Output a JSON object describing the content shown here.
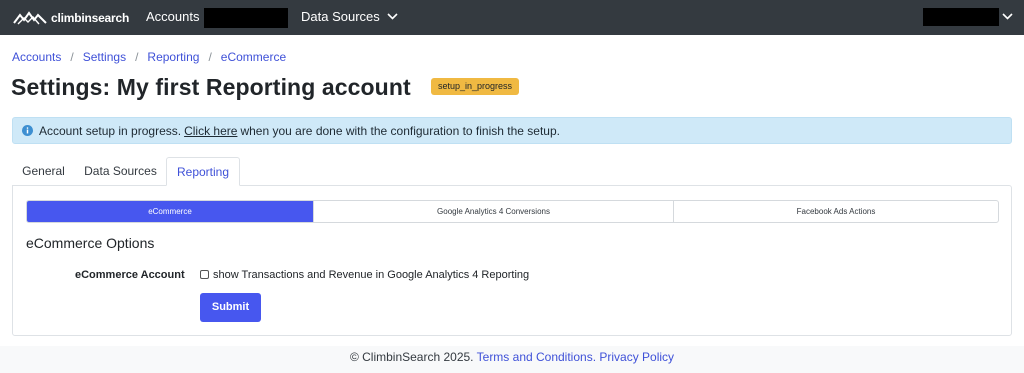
{
  "nav": {
    "brand": "climbinsearch",
    "accounts": "Accounts",
    "data_sources": "Data Sources"
  },
  "breadcrumb": [
    "Accounts",
    "Settings",
    "Reporting",
    "eCommerce"
  ],
  "page": {
    "title": "Settings: My first Reporting account",
    "status": "setup_in_progress"
  },
  "alert": {
    "prefix": "Account setup in progress.",
    "link": "Click here",
    "suffix": "when you are done with the configuration to finish the setup."
  },
  "tabs": [
    "General",
    "Data Sources",
    "Reporting"
  ],
  "subtabs": [
    "eCommerce",
    "Google Analytics 4 Conversions",
    "Facebook Ads Actions"
  ],
  "form": {
    "section_title": "eCommerce Options",
    "field_label": "eCommerce Account",
    "checkbox_label": "show Transactions and Revenue in Google Analytics 4 Reporting",
    "checkbox_checked": false,
    "submit": "Submit"
  },
  "footer": {
    "copyright": "© ClimbinSearch 2025.",
    "terms": "Terms and Conditions.",
    "privacy": "Privacy Policy"
  },
  "colors": {
    "navbar": "#343a40",
    "primary": "#4757ef",
    "link": "#3f51d8",
    "badge": "#f0b942",
    "alert_bg": "#cfe9f8"
  }
}
